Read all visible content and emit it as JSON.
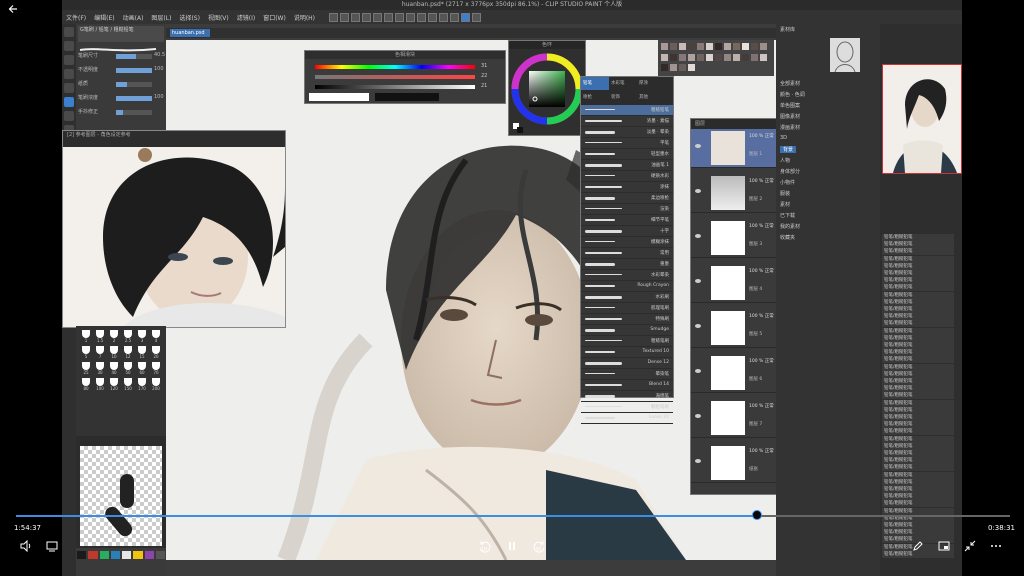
{
  "player": {
    "back_icon": "arrow-left-icon",
    "elapsed": "1:54:37",
    "duration": "0:38:31",
    "progress_fraction": 0.745,
    "rewind_seconds": "10",
    "forward_seconds": "30"
  },
  "app": {
    "title": "huanban.psd* (2717 x 3776px 350dpi 86.1%) - CLIP STUDIO PAINT 个人版",
    "menu": [
      "文件(F)",
      "编辑(E)",
      "动画(A)",
      "图层(L)",
      "选择(S)",
      "视图(V)",
      "滤镜(I)",
      "窗口(W)",
      "说明(H)"
    ],
    "canvas_tab": "huanban.psd"
  },
  "left_panel": {
    "header": "G笔刷 / 铅笔 / 粗糙铅笔",
    "props": [
      {
        "label": "笔刷尺寸",
        "value": "40.5",
        "fill": 0.55
      },
      {
        "label": "不透明度",
        "value": "100",
        "fill": 1.0
      },
      {
        "label": "纸质",
        "value": "",
        "fill": 0.3
      },
      {
        "label": "笔刷浓度",
        "value": "100",
        "fill": 1.0
      },
      {
        "label": "手抖修正",
        "value": "",
        "fill": 0.2
      }
    ],
    "brush_sizes": [
      "1",
      "1.5",
      "2",
      "2.5",
      "3",
      "4",
      "5",
      "7",
      "10",
      "12",
      "15",
      "20",
      "25",
      "30",
      "40",
      "50",
      "60",
      "70",
      "80",
      "100",
      "120",
      "150",
      "170",
      "200"
    ]
  },
  "ref_window": {
    "header": "[2] 参考图层 - 角色设定参考"
  },
  "hue_slider": {
    "header": "色相滑块",
    "values": [
      "31",
      "22",
      "21"
    ]
  },
  "color_wheel": {
    "header": "色环"
  },
  "brush_panel": {
    "tabs": [
      "铅笔",
      "水彩笔",
      "厚涂",
      "喷枪",
      "装饰",
      "其他"
    ],
    "items": [
      "粗糙铅笔",
      "浓墨 · 素描",
      "淡墨 · 晕染",
      "平笔",
      "轻型墨水",
      "油画笔 1",
      "硬质水彩",
      "涂抹",
      "柔边喷枪",
      "渲染",
      "细节平笔",
      "十字",
      "模糊涂抹",
      "常用",
      "重墨",
      "水彩晕染",
      "Rough Crayon",
      "水彩刷",
      "肌理笔刷",
      "特殊刷",
      "Smudge",
      "粗糙笔刷",
      "Textured 10",
      "Dense 12",
      "晕染笔",
      "Blend 14",
      "海绵笔",
      "颗粒笔刷",
      "Loose 20"
    ]
  },
  "layer_panel": {
    "header": "图层",
    "layers": [
      {
        "mode": "100 % 正常",
        "name": "图层 1"
      },
      {
        "mode": "100 % 正常",
        "name": "图层 2"
      },
      {
        "mode": "100 % 正常",
        "name": "图层 3"
      },
      {
        "mode": "100 % 正常",
        "name": "图层 4"
      },
      {
        "mode": "100 % 正常",
        "name": "图层 5"
      },
      {
        "mode": "100 % 正常",
        "name": "图层 6"
      },
      {
        "mode": "100 % 正常",
        "name": "图层 7"
      },
      {
        "mode": "100 % 正常",
        "name": "纸张"
      }
    ]
  },
  "material_panel": {
    "header": "素材库",
    "items": [
      "全部素材",
      "颜色 · 色调",
      "单色图案",
      "图像素材",
      "漫画素材",
      "3D",
      "背景",
      "人物",
      "身体部分",
      "小物件",
      "服装",
      "素材",
      "已下载",
      "我的素材",
      "收藏夹"
    ],
    "selected_index": 6
  },
  "history": {
    "entries": [
      "铅笔/粗糙铅笔",
      "铅笔/粗糙铅笔",
      "铅笔/粗糙铅笔",
      "铅笔/粗糙铅笔",
      "铅笔/粗糙铅笔",
      "铅笔/粗糙铅笔",
      "铅笔/粗糙铅笔",
      "铅笔/粗糙铅笔",
      "铅笔/粗糙铅笔",
      "铅笔/粗糙铅笔",
      "铅笔/粗糙铅笔",
      "铅笔/粗糙铅笔",
      "铅笔/粗糙铅笔",
      "铅笔/粗糙铅笔",
      "铅笔/粗糙铅笔",
      "铅笔/粗糙铅笔",
      "铅笔/粗糙铅笔",
      "铅笔/粗糙铅笔",
      "铅笔/粗糙铅笔",
      "铅笔/粗糙铅笔",
      "铅笔/粗糙铅笔",
      "铅笔/粗糙铅笔",
      "铅笔/粗糙铅笔",
      "铅笔/粗糙铅笔",
      "铅笔/粗糙铅笔",
      "铅笔/粗糙铅笔",
      "铅笔/粗糙铅笔",
      "铅笔/粗糙铅笔",
      "铅笔/粗糙铅笔",
      "铅笔/粗糙铅笔",
      "铅笔/粗糙铅笔",
      "铅笔/粗糙铅笔",
      "铅笔/粗糙铅笔",
      "铅笔/粗糙铅笔",
      "铅笔/粗糙铅笔",
      "铅笔/粗糙铅笔",
      "铅笔/粗糙铅笔",
      "铅笔/粗糙铅笔",
      "铅笔/粗糙铅笔",
      "铅笔/粗糙铅笔",
      "铅笔/粗糙铅笔",
      "铅笔/粗糙铅笔",
      "铅笔/粗糙铅笔",
      "铅笔/粗糙铅笔",
      "铅笔/粗糙铅笔"
    ]
  },
  "colors": {
    "accent": "#3b8ee0",
    "panel_bg": "#3a3a3a",
    "selection": "#3b6fb0"
  },
  "swatches": [
    "#1a1a1a",
    "#c0392b",
    "#27ae60",
    "#2980b9",
    "#e6e6e6",
    "#f1c40f",
    "#8e44ad",
    "#555555"
  ],
  "palette_colors": [
    "#a89a94",
    "#6b5d5a",
    "#c8bbb6",
    "#4a403e",
    "#8a7b77",
    "#d9cfcb",
    "#2f2826",
    "#b3a6a2",
    "#76685f",
    "#e8e0dc",
    "#5a4d49",
    "#9d8f8a",
    "#c5b7b0",
    "#3e3432",
    "#86787a",
    "#aea2a0",
    "#6f6360",
    "#dcd3d0",
    "#524744",
    "#938582",
    "#bdb0ab",
    "#453b39",
    "#7f7270",
    "#cfc5c2",
    "#312a28",
    "#a19492",
    "#6a5e5b",
    "#e2dad6"
  ]
}
